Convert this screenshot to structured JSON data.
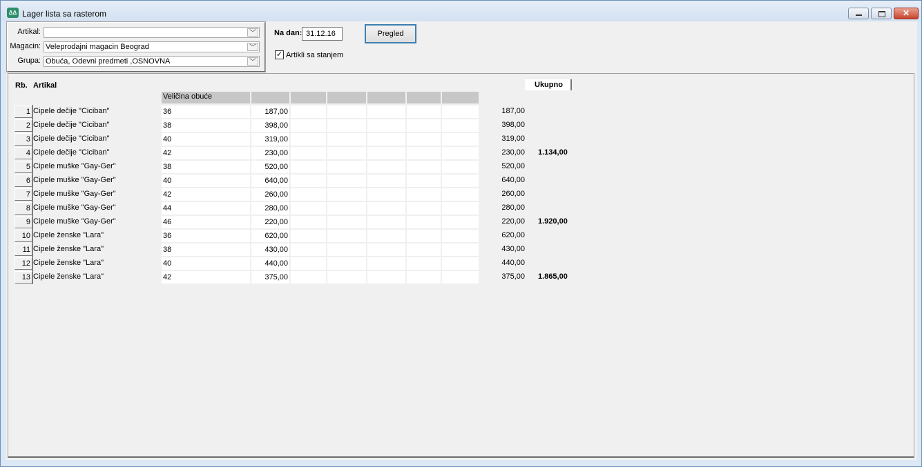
{
  "window": {
    "title": "Lager lista sa rasterom",
    "app_icon": "app-icon",
    "min_icon": "minimize-icon",
    "max_icon": "maximize-icon",
    "close_icon": "close-icon"
  },
  "filters": {
    "artikal_label": "Artikal:",
    "artikal_value": "",
    "magacin_label": "Magacin:",
    "magacin_value": "Veleprodajni magacin Beograd",
    "grupa_label": "Grupa:",
    "grupa_value": "Obuća, Odevni predmeti ,OSNOVNA",
    "date_label": "Na dan:",
    "date_value": "31.12.16",
    "pregled_label": "Pregled",
    "stock_checkbox_label": "Artikli sa stanjem",
    "stock_checked": "✓"
  },
  "grid": {
    "col_rb": "Rb.",
    "col_artikal": "Artikal",
    "col_ukupno": "Ukupno",
    "size_header": "Veličina obuće",
    "rows": [
      {
        "rb": "1",
        "artikal": "Cipele dečije \"Ciciban\"",
        "size": "36",
        "qty": "187,00",
        "total": "187,00",
        "group_total": ""
      },
      {
        "rb": "2",
        "artikal": "Cipele dečije \"Ciciban\"",
        "size": "38",
        "qty": "398,00",
        "total": "398,00",
        "group_total": ""
      },
      {
        "rb": "3",
        "artikal": "Cipele dečije \"Ciciban\"",
        "size": "40",
        "qty": "319,00",
        "total": "319,00",
        "group_total": ""
      },
      {
        "rb": "4",
        "artikal": "Cipele dečije \"Ciciban\"",
        "size": "42",
        "qty": "230,00",
        "total": "230,00",
        "group_total": "1.134,00"
      },
      {
        "rb": "5",
        "artikal": "Cipele muške \"Gay-Ger\"",
        "size": "38",
        "qty": "520,00",
        "total": "520,00",
        "group_total": ""
      },
      {
        "rb": "6",
        "artikal": "Cipele muške \"Gay-Ger\"",
        "size": "40",
        "qty": "640,00",
        "total": "640,00",
        "group_total": ""
      },
      {
        "rb": "7",
        "artikal": "Cipele muške \"Gay-Ger\"",
        "size": "42",
        "qty": "260,00",
        "total": "260,00",
        "group_total": ""
      },
      {
        "rb": "8",
        "artikal": "Cipele muške \"Gay-Ger\"",
        "size": "44",
        "qty": "280,00",
        "total": "280,00",
        "group_total": ""
      },
      {
        "rb": "9",
        "artikal": "Cipele muške \"Gay-Ger\"",
        "size": "46",
        "qty": "220,00",
        "total": "220,00",
        "group_total": "1.920,00"
      },
      {
        "rb": "10",
        "artikal": "Cipele ženske \"Lara\"",
        "size": "36",
        "qty": "620,00",
        "total": "620,00",
        "group_total": ""
      },
      {
        "rb": "11",
        "artikal": "Cipele ženske \"Lara\"",
        "size": "38",
        "qty": "430,00",
        "total": "430,00",
        "group_total": ""
      },
      {
        "rb": "12",
        "artikal": "Cipele ženske \"Lara\"",
        "size": "40",
        "qty": "440,00",
        "total": "440,00",
        "group_total": ""
      },
      {
        "rb": "13",
        "artikal": "Cipele ženske \"Lara\"",
        "size": "42",
        "qty": "375,00",
        "total": "375,00",
        "group_total": "1.865,00"
      }
    ]
  }
}
